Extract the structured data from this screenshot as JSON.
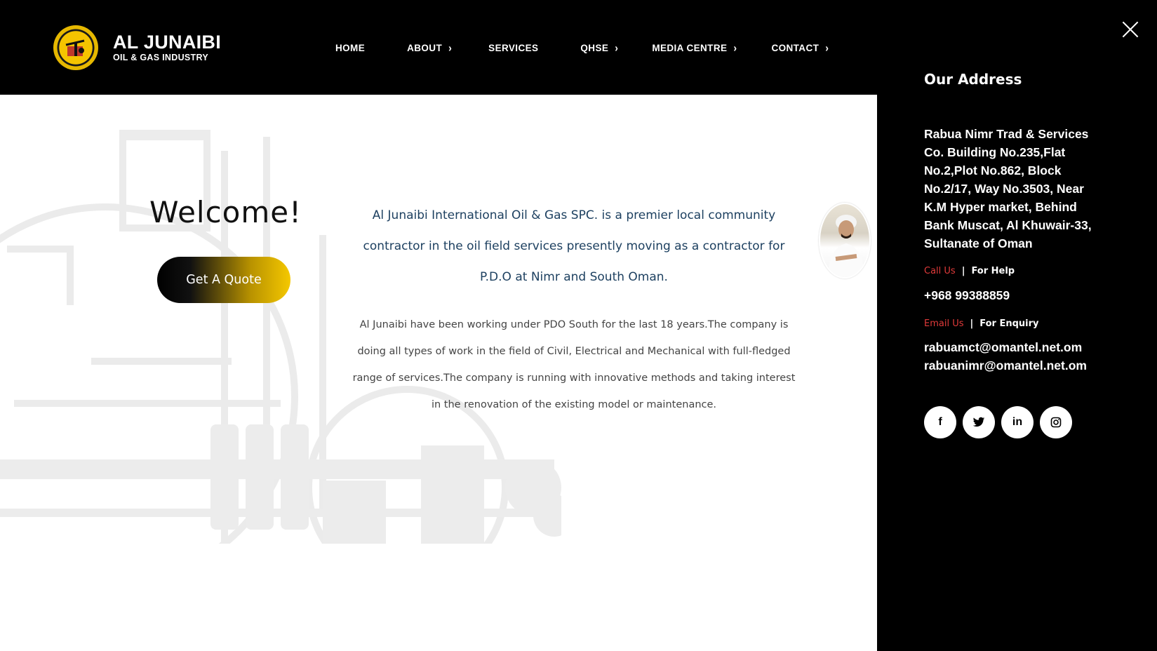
{
  "header": {
    "brand_name": "AL JUNAIBI",
    "brand_sub": "OIL & GAS INDUSTRY"
  },
  "nav": {
    "items": [
      {
        "label": "HOME"
      },
      {
        "label": "ABOUT"
      },
      {
        "label": "SERVICES"
      },
      {
        "label": "QHSE"
      },
      {
        "label": "MEDIA CENTRE"
      },
      {
        "label": "CONTACT"
      }
    ]
  },
  "main": {
    "welcome": "Welcome!",
    "quote_button": "Get A Quote",
    "lead": "Al Junaibi International Oil & Gas SPC. is a premier local community contractor in the oil field services presently moving as a contractor for P.D.O at Nimr and South Oman.",
    "body": "Al Junaibi have been working under PDO South for the last 18 years.The company is doing all types of work in the field of Civil, Electrical and Mechanical with full-fledged range of services.The company is running with innovative methods and taking interest in the renovation of the existing model or maintenance."
  },
  "panel": {
    "title": "Our Address",
    "address": "Rabua Nimr Trad & Services Co. Building No.235,Flat No.2,Plot No.862, Block No.2/17, Way No.3503, Near K.M Hyper market, Behind Bank Muscat, Al Khuwair-33, Sultanate of Oman",
    "call_label": "Call Us",
    "call_sep": "|",
    "call_help": "For Help",
    "phone": "+968 99388859",
    "email_label": "Email Us",
    "email_sep": "|",
    "email_help": "For Enquiry",
    "email1": "rabuamct@omantel.net.om",
    "email2": "rabuanimr@omantel.net.om",
    "socials": [
      {
        "icon": "facebook-icon",
        "glyph": "f"
      },
      {
        "icon": "twitter-icon",
        "glyph": ""
      },
      {
        "icon": "linkedin-icon",
        "glyph": "in"
      },
      {
        "icon": "instagram-icon",
        "glyph": ""
      }
    ]
  },
  "colors": {
    "header_bg": "#000000",
    "accent_gold": "#f5c800",
    "lead_text": "#1d4060",
    "accent_red": "#e03a3a"
  }
}
